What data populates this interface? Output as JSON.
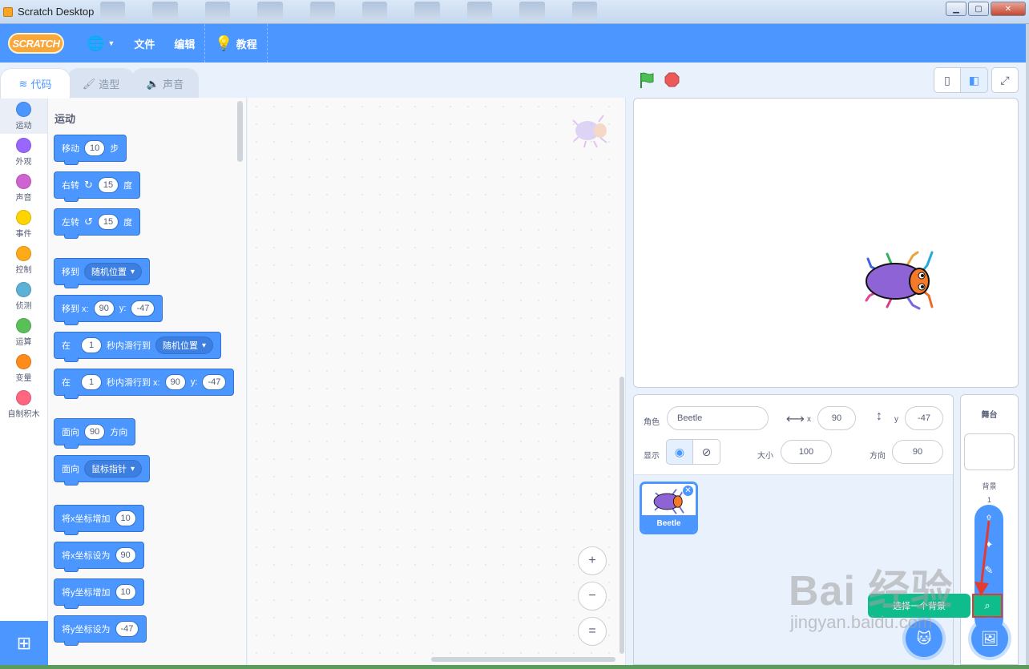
{
  "window": {
    "title": "Scratch Desktop",
    "minimize": "▁",
    "maximize": "▢",
    "close": "✕"
  },
  "menubar": {
    "logo": "SCRATCH",
    "language_icon": "globe-icon",
    "file": "文件",
    "edit": "编辑",
    "tutorials": "教程"
  },
  "tabs": [
    {
      "label": "代码",
      "icon": "code-icon"
    },
    {
      "label": "造型",
      "icon": "brush-icon"
    },
    {
      "label": "声音",
      "icon": "speaker-icon"
    }
  ],
  "categories": [
    {
      "label": "运动",
      "color": "#4c97ff"
    },
    {
      "label": "外观",
      "color": "#9966ff"
    },
    {
      "label": "声音",
      "color": "#cf63cf"
    },
    {
      "label": "事件",
      "color": "#ffd500"
    },
    {
      "label": "控制",
      "color": "#ffab19"
    },
    {
      "label": "侦测",
      "color": "#5cb1d6"
    },
    {
      "label": "运算",
      "color": "#59c059"
    },
    {
      "label": "变量",
      "color": "#ff8c1a"
    },
    {
      "label": "自制积木",
      "color": "#ff6680"
    }
  ],
  "palette": {
    "section_title": "运动",
    "move": {
      "label": "移动",
      "steps": "10",
      "unit": "步"
    },
    "turn_right": {
      "label": "右转",
      "degrees": "15",
      "unit": "度"
    },
    "turn_left": {
      "label": "左转",
      "degrees": "15",
      "unit": "度"
    },
    "goto": {
      "label": "移到",
      "target": "随机位置"
    },
    "goto_xy": {
      "label": "移到 x:",
      "x": "90",
      "ylabel": "y:",
      "y": "-47"
    },
    "glide": {
      "prefix": "在",
      "secs": "1",
      "label": "秒内滑行到",
      "target": "随机位置"
    },
    "glide_xy": {
      "prefix": "在",
      "secs": "1",
      "label": "秒内滑行到 x:",
      "x": "90",
      "ylabel": "y:",
      "y": "-47"
    },
    "point_dir": {
      "label": "面向",
      "dir": "90",
      "unit": "方向"
    },
    "point_towards": {
      "label": "面向",
      "target": "鼠标指针"
    },
    "change_x": {
      "label": "将x坐标增加",
      "value": "10"
    },
    "set_x": {
      "label": "将x坐标设为",
      "value": "90"
    },
    "change_y": {
      "label": "将y坐标增加",
      "value": "10"
    },
    "set_y": {
      "label": "将y坐标设为",
      "value": "-47"
    }
  },
  "zoom": {
    "in": "+",
    "out": "−",
    "reset": "="
  },
  "sprite_info": {
    "sprite_label": "角色",
    "sprite_name": "Beetle",
    "x_label": "x",
    "x": "90",
    "y_label": "y",
    "y": "-47",
    "show_label": "显示",
    "size_label": "大小",
    "size": "100",
    "direction_label": "方向",
    "direction": "90"
  },
  "sprites": [
    {
      "name": "Beetle"
    }
  ],
  "stage_pane": {
    "title": "舞台",
    "backdrops_label": "背景",
    "backdrops_count": "1"
  },
  "backdrop_menu": {
    "tooltip": "选择一个背景"
  },
  "watermark": {
    "main": "Bai 经验",
    "sub": "jingyan.baidu.com"
  },
  "colors": {
    "accent": "#4c97ff",
    "menubar": "#4c97ff",
    "extension_green": "#0fbd8c",
    "highlight_red": "#e23b32"
  }
}
